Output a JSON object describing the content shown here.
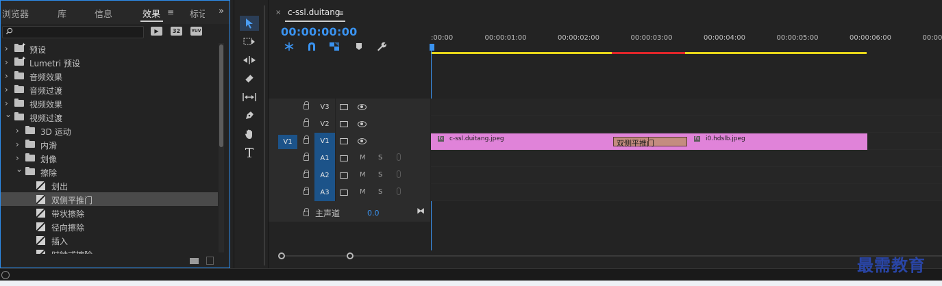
{
  "effects_panel": {
    "tabs": [
      {
        "label": "浏览器"
      },
      {
        "label": "库"
      },
      {
        "label": "信息"
      },
      {
        "label": "效果",
        "active": true
      },
      {
        "label": "标记"
      }
    ],
    "menu_glyph": "≡",
    "overflow_glyph": "»",
    "search": {
      "value": "",
      "placeholder": ""
    },
    "filter_buttons": [
      "▶",
      "32",
      "YUV"
    ],
    "tree": [
      {
        "label": "预设",
        "kind": "preset-folder",
        "depth": 0,
        "expanded": false
      },
      {
        "label": "Lumetri 预设",
        "kind": "preset-folder",
        "depth": 0,
        "expanded": false
      },
      {
        "label": "音频效果",
        "kind": "folder",
        "depth": 0,
        "expanded": false
      },
      {
        "label": "音频过渡",
        "kind": "folder",
        "depth": 0,
        "expanded": false
      },
      {
        "label": "视频效果",
        "kind": "folder",
        "depth": 0,
        "expanded": false
      },
      {
        "label": "视频过渡",
        "kind": "folder",
        "depth": 0,
        "expanded": true
      },
      {
        "label": "3D 运动",
        "kind": "folder",
        "depth": 1,
        "expanded": false
      },
      {
        "label": "内滑",
        "kind": "folder",
        "depth": 1,
        "expanded": false
      },
      {
        "label": "划像",
        "kind": "folder",
        "depth": 1,
        "expanded": false
      },
      {
        "label": "擦除",
        "kind": "folder",
        "depth": 1,
        "expanded": true
      },
      {
        "label": "划出",
        "kind": "effect",
        "depth": 2
      },
      {
        "label": "双侧平推门",
        "kind": "effect",
        "depth": 2,
        "selected": true
      },
      {
        "label": "带状擦除",
        "kind": "effect",
        "depth": 2
      },
      {
        "label": "径向擦除",
        "kind": "effect",
        "depth": 2
      },
      {
        "label": "插入",
        "kind": "effect",
        "depth": 2
      },
      {
        "label": "时钟式擦除",
        "kind": "effect",
        "depth": 2
      }
    ]
  },
  "timeline": {
    "sequence_close": "×",
    "sequence_name": "c-ssl.duitang",
    "sequence_menu": "≡",
    "timecode": "00:00:00:00",
    "ruler_labels": [
      ":00:00",
      "00:00:01:00",
      "00:00:02:00",
      "00:00:03:00",
      "00:00:04:00",
      "00:00:05:00",
      "00:00:06:00",
      "00:00:0"
    ],
    "tracks": [
      {
        "name": "V3",
        "type": "video",
        "target": false,
        "source": ""
      },
      {
        "name": "V2",
        "type": "video",
        "target": false,
        "source": ""
      },
      {
        "name": "V1",
        "type": "video",
        "target": true,
        "source": "V1"
      },
      {
        "name": "A1",
        "type": "audio",
        "target": true,
        "source": ""
      },
      {
        "name": "A2",
        "type": "audio",
        "target": true,
        "source": ""
      },
      {
        "name": "A3",
        "type": "audio",
        "target": true,
        "source": ""
      }
    ],
    "mute_label": "M",
    "solo_label": "S",
    "master": {
      "label": "主声道",
      "value": "0.0"
    },
    "clips": [
      {
        "name": "c-ssl.duitang.jpeg",
        "fx": "fx"
      },
      {
        "name": "i0.hdslb.jpeg",
        "fx": "fx"
      }
    ],
    "transition": {
      "label": "双侧平推门"
    },
    "colors": {
      "accent": "#3a93f0",
      "clip_video": "#e083d9",
      "transition": "#c48c80",
      "render_yellow": "#e6d51a",
      "render_red": "#e0262a",
      "target_on": "#1c5389"
    }
  },
  "tools": [
    "selection-tool",
    "track-select-tool",
    "ripple-edit-tool",
    "razor-tool",
    "slip-tool",
    "pen-tool",
    "hand-tool",
    "type-tool"
  ],
  "watermark": "最需教育"
}
